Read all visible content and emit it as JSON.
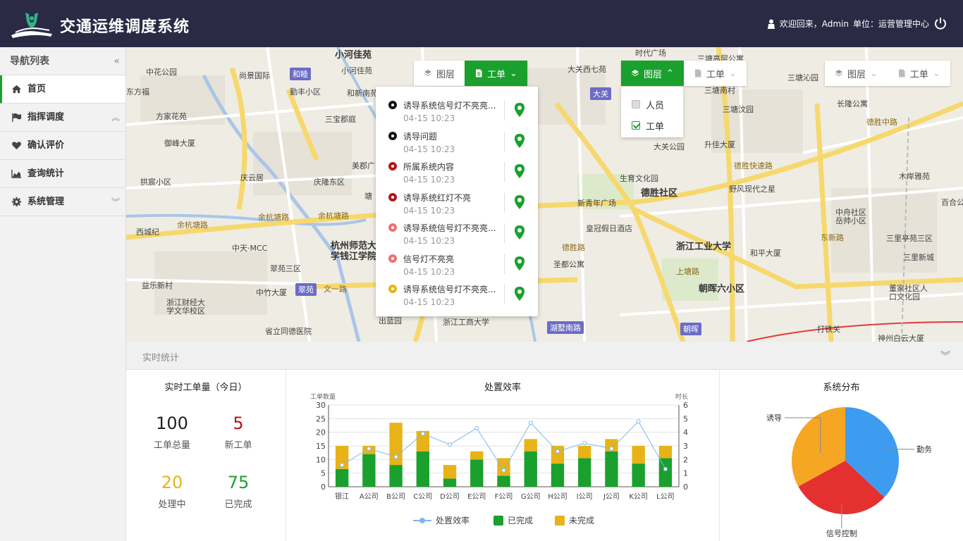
{
  "header": {
    "title": "交通运维调度系统",
    "welcome": "欢迎回来，Admin",
    "unit": "单位：运营管理中心"
  },
  "sidebar": {
    "title": "导航列表",
    "items": [
      {
        "label": "首页",
        "icon": "home-icon"
      },
      {
        "label": "指挥调度",
        "icon": "flag-icon"
      },
      {
        "label": "确认评价",
        "icon": "heart-icon"
      },
      {
        "label": "查询统计",
        "icon": "area-chart-icon"
      },
      {
        "label": "系统管理",
        "icon": "gear-icon"
      }
    ]
  },
  "map": {
    "labels": {
      "l1": "小河佳苑",
      "l2": "中花公园",
      "l3": "尚景国际",
      "l4": "小河佳苑",
      "l5": "东方福",
      "l6": "勤丰小区",
      "l7": "和新南苑",
      "l8": "方家花苑",
      "l9": "三宝郡庭",
      "l10": "御峰大厦",
      "l11": "美郡广",
      "l12": "拱宸小区",
      "l13": "庆云居",
      "l14": "庆隆东区",
      "l15": "塘",
      "l16": "余杭塘路",
      "l17": "余杭塘路",
      "l18": "余杭塘路",
      "l19": "西城纪",
      "l20": "中天·MCC",
      "l21": "杭州师范大",
      "l22": "学钱江学院",
      "l23": "翠苑三区",
      "l24": "益乐新村",
      "l25": "中竹大厦",
      "l26": "文一路",
      "l27": "浙江财经大",
      "l28": "学文华校区",
      "l29": "省立同德医院",
      "l30": "出蓝园",
      "l31": "浙江工商大学",
      "l32": "时代广场",
      "l33": "大关西七苑",
      "l34": "三塘高层公寓",
      "l35": "三塘沁园",
      "l36": "三塘南村",
      "l37": "三塘汶园",
      "l38": "长隆公寓",
      "l39": "升佳大厦",
      "l40": "大关公园",
      "l41": "生育文化园",
      "l42": "德胜社区",
      "l43": "野风现代之星",
      "l44": "德胜快速路",
      "l45": "德胜中路",
      "l46": "新青年广场",
      "l47": "皇冠假日酒店",
      "l48": "浙江工业大学",
      "l49": "和平大厦",
      "l50": "圣都公寓",
      "l51": "朝晖六小区",
      "l52": "中舟社区",
      "l53": "岳帅小区",
      "l54": "三里亭苑三区",
      "l55": "三里新城",
      "l56": "董家社区人",
      "l57": "口文化园",
      "l58": "打铁关",
      "l59": "神州白云大厦",
      "l60": "木岸雅苑",
      "l61": "百合公",
      "l62": "德胜路",
      "l63": "湖墅南路",
      "l64": "上塘路",
      "l65": "东新路",
      "l66": "和睦",
      "l67": "大关",
      "l68": "翠苑",
      "l69": "朝晖"
    }
  },
  "toolbar_left": {
    "layer": "图层",
    "order": "工单"
  },
  "toolbar_mid": {
    "layer": "图层",
    "order": "工单"
  },
  "toolbar_right": {
    "layer": "图层",
    "order": "工单"
  },
  "work_orders": [
    {
      "title": "诱导系统信号灯不亮亮...",
      "time": "04-15 10:23",
      "color": "#111111"
    },
    {
      "title": "诱导问题",
      "time": "04-15 10:23",
      "color": "#111111"
    },
    {
      "title": "所属系统内容",
      "time": "04-15 10:23",
      "color": "#b3141b"
    },
    {
      "title": "诱导系统红灯不亮",
      "time": "04-15 10:23",
      "color": "#b3141b"
    },
    {
      "title": "诱导系统信号灯不亮亮...",
      "time": "04-15 10:23",
      "color": "#f07070"
    },
    {
      "title": "信号灯不亮亮",
      "time": "04-15 10:23",
      "color": "#f07070"
    },
    {
      "title": "诱导系统信号灯不亮亮...",
      "time": "04-15 10:23",
      "color": "#e7b317"
    }
  ],
  "layer_dropdown": {
    "items": [
      {
        "label": "人员",
        "checked": false
      },
      {
        "label": "工单",
        "checked": true
      }
    ]
  },
  "stats": {
    "title": "实时统计",
    "kpi_title": "实时工单量（今日）",
    "kpis": [
      {
        "value": "100",
        "label": "工单总量",
        "color": "#222222"
      },
      {
        "value": "5",
        "label": "新工单",
        "color": "#b3141b"
      },
      {
        "value": "20",
        "label": "处理中",
        "color": "#e7b317"
      },
      {
        "value": "75",
        "label": "已完成",
        "color": "#1aa02d"
      }
    ],
    "efficiency_title": "处置效率",
    "distribution_title": "系统分布"
  },
  "chart_data": [
    {
      "type": "bar",
      "title": "处置效率",
      "categories": [
        "银江",
        "A公司",
        "B公司",
        "C公司",
        "D公司",
        "E公司",
        "F公司",
        "G公司",
        "H公司",
        "I公司",
        "J公司",
        "K公司",
        "L公司"
      ],
      "stacked": true,
      "ylabel": "工单数量",
      "ylim": [
        0,
        30
      ],
      "y2label": "时长",
      "y2lim": [
        0,
        6
      ],
      "series": [
        {
          "name": "已完成",
          "type": "bar",
          "color": "#1aa02d",
          "values": [
            6.5,
            12,
            8,
            13,
            3,
            10,
            4,
            13,
            8.5,
            10.5,
            13,
            8.5,
            10.5
          ]
        },
        {
          "name": "未完成",
          "type": "bar",
          "color": "#e7b317",
          "values": [
            8.5,
            3,
            15.5,
            7.5,
            5,
            3,
            6.5,
            4.5,
            6.5,
            4.5,
            4.5,
            6.5,
            4.5
          ]
        },
        {
          "name": "处置效率",
          "type": "line",
          "axis": "y2",
          "color": "#7db8f0",
          "values": [
            1.6,
            2.8,
            2.2,
            3.9,
            3.1,
            4.3,
            1.2,
            4.7,
            2.6,
            3.2,
            2.8,
            4.8,
            1.3
          ]
        }
      ],
      "legend": "bottom"
    },
    {
      "type": "pie",
      "title": "系统分布",
      "labels": [
        "勤务",
        "信号控制",
        "诱导"
      ],
      "values": [
        37,
        30,
        33
      ],
      "colors": [
        "#3d9cf0",
        "#e53030",
        "#f5a623"
      ]
    }
  ]
}
